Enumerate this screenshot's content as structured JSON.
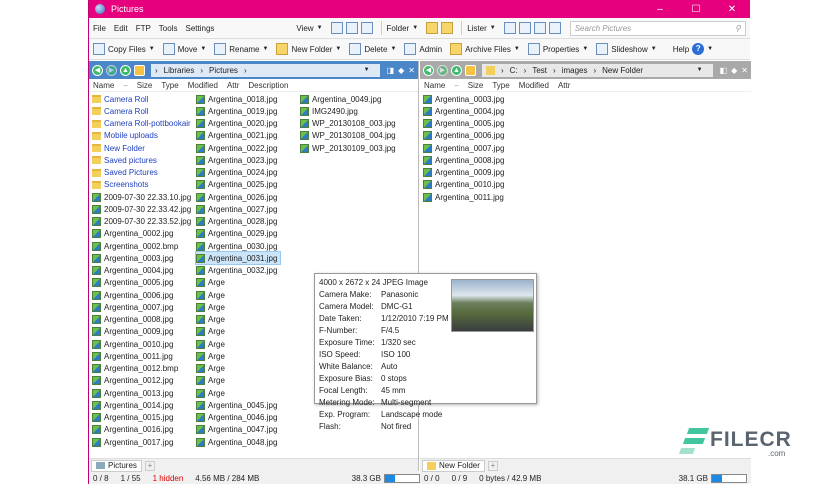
{
  "window": {
    "title": "Pictures",
    "controls": [
      "–",
      "☐",
      "✕"
    ]
  },
  "menu": [
    "File",
    "Edit",
    "FTP",
    "Tools",
    "Settings"
  ],
  "view_groups": [
    "View",
    "Folder",
    "Lister"
  ],
  "search": {
    "placeholder": "Search Pictures"
  },
  "toolbar": [
    "Copy Files",
    "Move",
    "Rename",
    "New Folder",
    "Delete",
    "Admin",
    "Archive Files",
    "Properties",
    "Slideshow"
  ],
  "help_label": "Help",
  "left": {
    "path": [
      "Libraries",
      "Pictures"
    ],
    "columns": [
      "Name",
      "Size",
      "Type",
      "Modified",
      "Attr",
      "Description"
    ],
    "folders": [
      "Camera Roll",
      "Camera Roll",
      "Camera Roll-pottbookair",
      "Mobile uploads",
      "New Folder",
      "Saved pictures",
      "Saved Pictures",
      "Screenshots"
    ],
    "files_col1": [
      "2009-07-30 22.33.10.jpg",
      "2009-07-30 22.33.42.jpg",
      "2009-07-30 22.33.52.jpg",
      "Argentina_0002.jpg",
      "Argentina_0002.bmp",
      "Argentina_0003.jpg",
      "Argentina_0004.jpg",
      "Argentina_0005.jpg",
      "Argentina_0006.jpg",
      "Argentina_0007.jpg",
      "Argentina_0008.jpg",
      "Argentina_0009.jpg",
      "Argentina_0010.jpg",
      "Argentina_0011.jpg",
      "Argentina_0012.bmp",
      "Argentina_0012.jpg",
      "Argentina_0013.jpg",
      "Argentina_0014.jpg",
      "Argentina_0015.jpg",
      "Argentina_0016.jpg",
      "Argentina_0017.jpg"
    ],
    "files_col2": [
      "Argentina_0018.jpg",
      "Argentina_0019.jpg",
      "Argentina_0020.jpg",
      "Argentina_0021.jpg",
      "Argentina_0022.jpg",
      "Argentina_0023.jpg",
      "Argentina_0024.jpg",
      "Argentina_0025.jpg",
      "Argentina_0026.jpg",
      "Argentina_0027.jpg",
      "Argentina_0028.jpg",
      "Argentina_0029.jpg",
      "Argentina_0030.jpg",
      "Argentina_0031.jpg",
      "Argentina_0032.jpg",
      "Arge",
      "Arge",
      "Arge",
      "Arge",
      "Arge",
      "Arge",
      "Arge",
      "Arge",
      "Arge",
      "Arge",
      "Argentina_0045.jpg",
      "Argentina_0046.jpg",
      "Argentina_0047.jpg",
      "Argentina_0048.jpg"
    ],
    "files_col3": [
      "Argentina_0049.jpg",
      "IMG2490.jpg",
      "WP_20130108_003.jpg",
      "WP_20130108_004.jpg",
      "WP_20130109_003.jpg"
    ],
    "selected": "Argentina_0031.jpg",
    "tab": "Pictures",
    "status": {
      "folders": "0 / 8",
      "files": "1 / 55",
      "hidden": "1 hidden",
      "size": "4.56 MB / 284 MB",
      "free": "38.3 GB",
      "used_fraction": 0.3
    }
  },
  "right": {
    "path": [
      "C:",
      "Test",
      "images",
      "New Folder"
    ],
    "columns": [
      "Name",
      "Size",
      "Type",
      "Modified",
      "Attr"
    ],
    "files": [
      "Argentina_0003.jpg",
      "Argentina_0004.jpg",
      "Argentina_0005.jpg",
      "Argentina_0006.jpg",
      "Argentina_0007.jpg",
      "Argentina_0008.jpg",
      "Argentina_0009.jpg",
      "Argentina_0010.jpg",
      "Argentina_0011.jpg"
    ],
    "tab": "New Folder",
    "status": {
      "folders": "0 / 0",
      "files": "0 / 9",
      "size": "0 bytes / 42.9 MB",
      "free": "38.1 GB",
      "used_fraction": 0.3
    }
  },
  "tooltip": {
    "header": "4000 x 2672 x 24 JPEG Image",
    "fields": [
      [
        "Camera Make:",
        "Panasonic"
      ],
      [
        "Camera Model:",
        "DMC-G1"
      ],
      [
        "Date Taken:",
        "1/12/2010 7:19 PM"
      ],
      [
        "F-Number:",
        "F/4.5"
      ],
      [
        "Exposure Time:",
        "1/320 sec"
      ],
      [
        "ISO Speed:",
        "ISO 100"
      ],
      [
        "White Balance:",
        "Auto"
      ],
      [
        "Exposure Bias:",
        "0 stops"
      ],
      [
        "Focal Length:",
        "45 mm"
      ],
      [
        "Metering Mode:",
        "Multi-segment"
      ],
      [
        "Exp. Program:",
        "Landscape mode"
      ],
      [
        "Flash:",
        "Not fired"
      ]
    ]
  },
  "watermark": {
    "text": "FILECR",
    ".com": ".com"
  }
}
